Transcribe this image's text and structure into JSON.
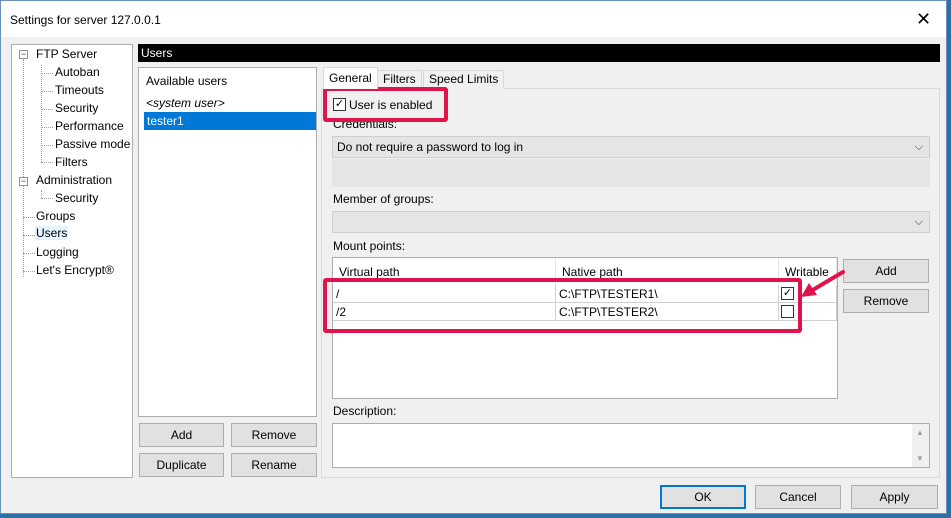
{
  "window": {
    "title": "Settings for server 127.0.0.1"
  },
  "tree": {
    "items": [
      {
        "label": "FTP Server"
      },
      {
        "label": "Autoban"
      },
      {
        "label": "Timeouts"
      },
      {
        "label": "Security"
      },
      {
        "label": "Performance"
      },
      {
        "label": "Passive mode"
      },
      {
        "label": "Filters"
      },
      {
        "label": "Administration"
      },
      {
        "label": "Security"
      },
      {
        "label": "Groups"
      },
      {
        "label": "Users"
      },
      {
        "label": "Logging"
      },
      {
        "label": "Let's Encrypt®"
      }
    ],
    "toggle_symbol": "−"
  },
  "header": {
    "title": "Users"
  },
  "users": {
    "header": "Available users",
    "system_user": "<system user>",
    "selected": "tester1",
    "add_label": "Add",
    "remove_label": "Remove",
    "duplicate_label": "Duplicate",
    "rename_label": "Rename"
  },
  "tabs": [
    {
      "label": "General"
    },
    {
      "label": "Filters"
    },
    {
      "label": "Speed Limits"
    }
  ],
  "general": {
    "user_enabled_label": "User is enabled",
    "user_enabled_checked": true,
    "credentials_label": "Credentials:",
    "credentials_value": "Do not require a password to log in",
    "member_label": "Member of groups:",
    "member_value": "",
    "mount_label": "Mount points:",
    "mount_columns": [
      "Virtual path",
      "Native path",
      "Writable"
    ],
    "mount_rows": [
      {
        "virtual": "/",
        "native": "C:\\FTP\\TESTER1\\",
        "writable": true
      },
      {
        "virtual": "/2",
        "native": "C:\\FTP\\TESTER2\\",
        "writable": false
      }
    ],
    "mount_add_label": "Add",
    "mount_remove_label": "Remove",
    "description_label": "Description:",
    "description_value": ""
  },
  "footer": {
    "ok_label": "OK",
    "cancel_label": "Cancel",
    "apply_label": "Apply"
  },
  "colors": {
    "selection": "#0078d7",
    "annotation": "#e0144c"
  },
  "icons": {
    "close": "close-icon",
    "dropdown": "chevron-down-icon",
    "checkmark": "checkmark-icon",
    "arrow": "annotation-arrow-icon"
  }
}
